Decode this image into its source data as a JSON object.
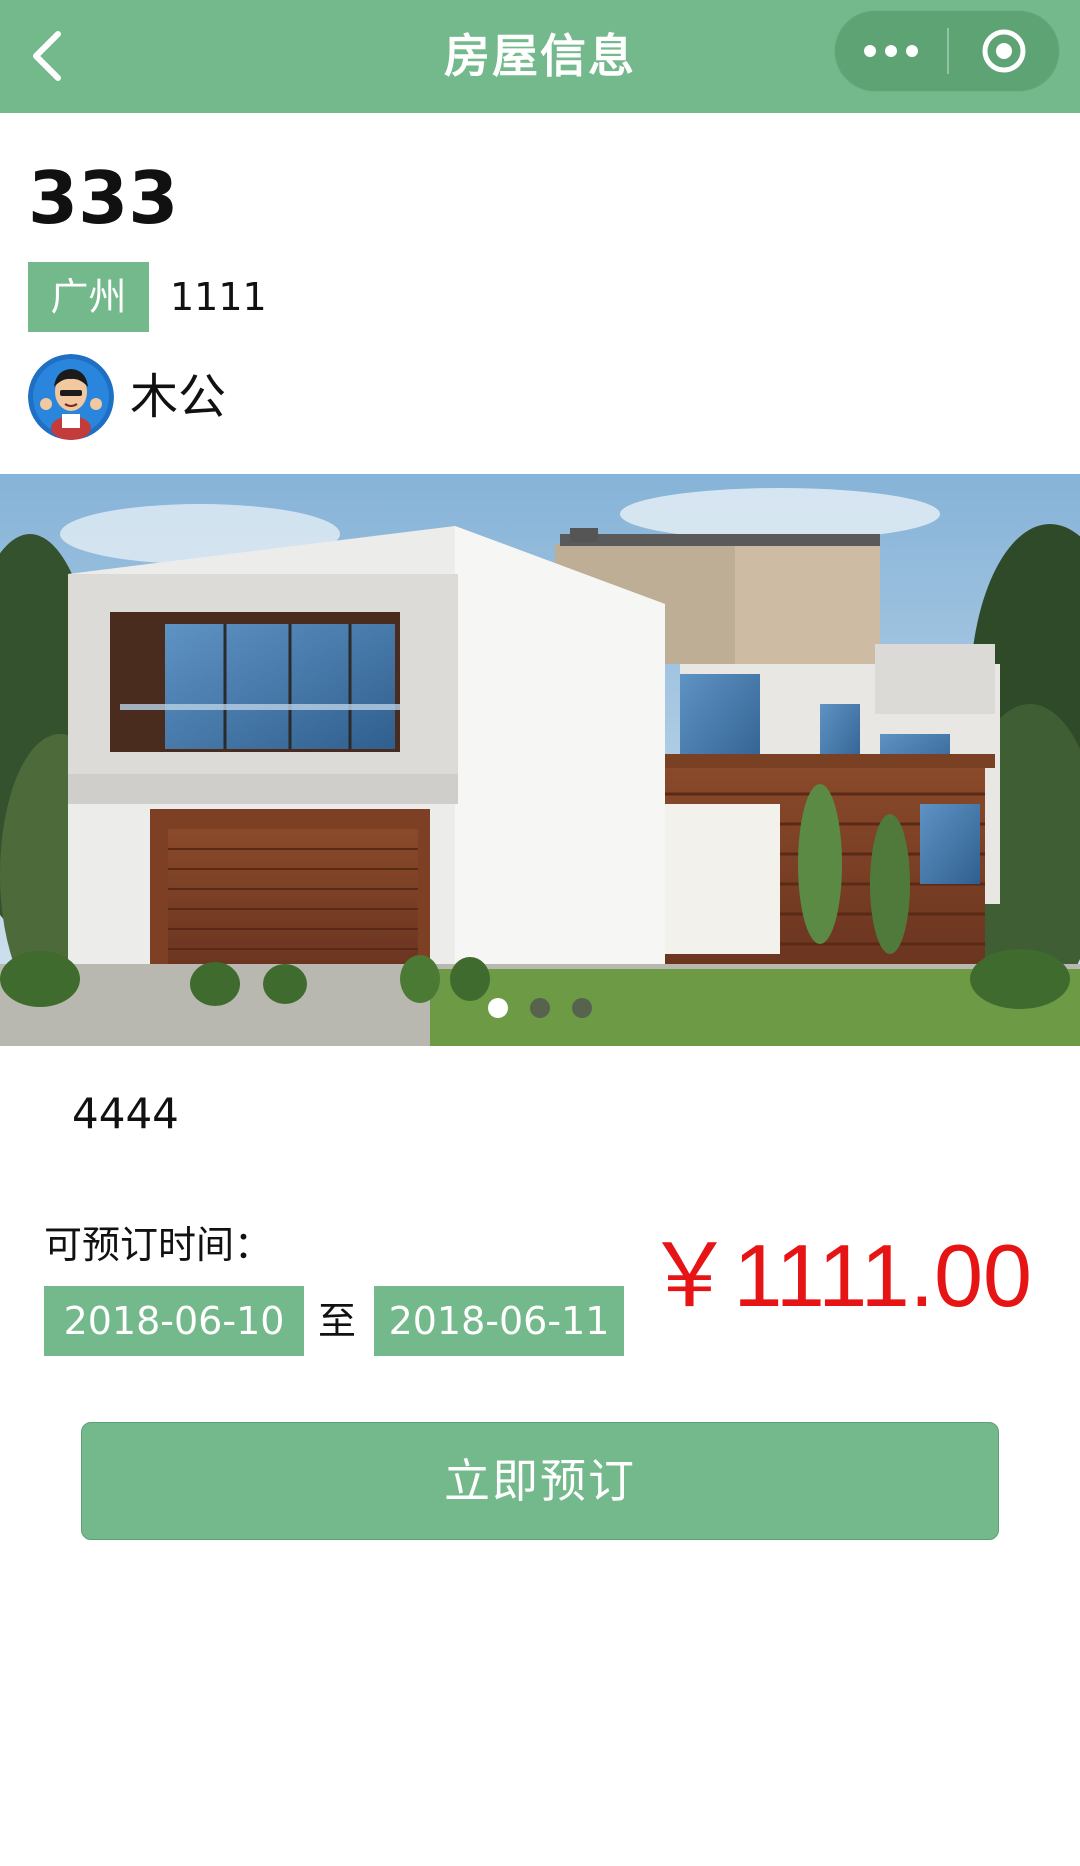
{
  "navbar": {
    "title": "房屋信息",
    "back_icon": "chevron-left-icon",
    "more_icon": "more-dots-icon",
    "close_icon": "target-circle-icon",
    "background": "#74b98b"
  },
  "house": {
    "title": "333",
    "city": "广州",
    "address": "1111",
    "owner_name": "木公",
    "description": "4444"
  },
  "gallery": {
    "slide_count": 3,
    "active_index": 0
  },
  "booking": {
    "label": "可预订时间：",
    "date_from": "2018-06-10",
    "separator": "至",
    "date_to": "2018-06-11",
    "price": "￥1111.00",
    "button_label": "立即预订"
  },
  "colors": {
    "accent": "#74b98b",
    "price": "#e61414"
  }
}
